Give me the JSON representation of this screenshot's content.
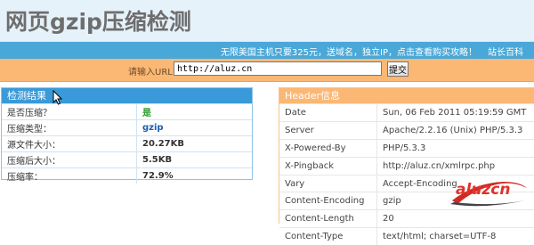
{
  "header": {
    "title": "网页gzip压缩检测"
  },
  "promo": {
    "text": "无限美国主机只要325元，送域名，独立IP，点击查看购买攻略！",
    "link": "站长百科"
  },
  "url_bar": {
    "label": "请输入URL：",
    "value": "http://aluz.cn",
    "button": "提交"
  },
  "result": {
    "heading": "检测结果",
    "rows": [
      {
        "label": "是否压缩？",
        "value": "是"
      },
      {
        "label": "压缩类型：",
        "value": "gzip"
      },
      {
        "label": "源文件大小：",
        "value": "20.27KB"
      },
      {
        "label": "压缩后大小：",
        "value": "5.5KB"
      },
      {
        "label": "压缩率：",
        "value": "72.9%"
      }
    ]
  },
  "headers_info": {
    "heading": "Header信息",
    "rows": [
      {
        "label": "Date",
        "value": "Sun, 06 Feb 2011 05:19:59 GMT"
      },
      {
        "label": "Server",
        "value": "Apache/2.2.16 (Unix) PHP/5.3.3"
      },
      {
        "label": "X-Powered-By",
        "value": "PHP/5.3.3"
      },
      {
        "label": "X-Pingback",
        "value": "http://aluz.cn/xmlrpc.php"
      },
      {
        "label": "Vary",
        "value": "Accept-Encoding"
      },
      {
        "label": "Content-Encoding",
        "value": "gzip"
      },
      {
        "label": "Content-Length",
        "value": "20"
      },
      {
        "label": "Content-Type",
        "value": "text/html; charset=UTF-8"
      }
    ]
  },
  "watermark": {
    "text": "aluzcn"
  },
  "colors": {
    "blue_bar": "#4aa8d8",
    "orange_bar": "#fbb774",
    "green_value": "#2a9a2a",
    "blue_value": "#1a5fb4",
    "logo": "#e0322b"
  }
}
